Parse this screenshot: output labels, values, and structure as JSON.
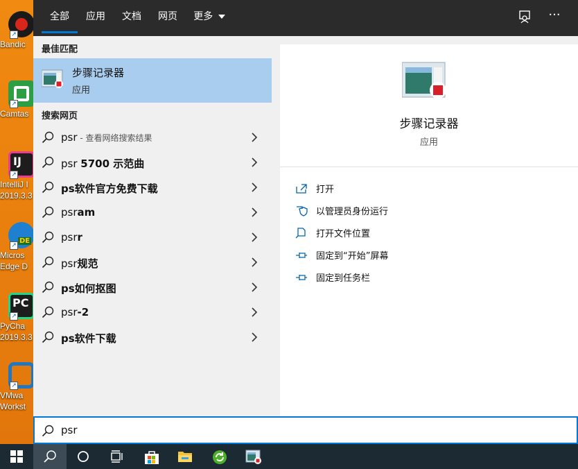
{
  "desktop": {
    "icons": [
      {
        "label": "Bandic",
        "color": "#c0392b"
      },
      {
        "label": "Camtas",
        "color": "#2e9e44"
      },
      {
        "label": "IntelliJ I\n2019.3.3",
        "color": "#1d1d1d"
      },
      {
        "label": "Micros\nEdge D",
        "color": "#1f7fd1"
      },
      {
        "label": "PyCha\n2019.3.3",
        "color": "#21d789"
      },
      {
        "label": "VMwa\nWorkst",
        "color": "#1f78c1"
      }
    ]
  },
  "nav": {
    "tabs": [
      {
        "label": "全部",
        "active": true
      },
      {
        "label": "应用",
        "active": false
      },
      {
        "label": "文档",
        "active": false
      },
      {
        "label": "网页",
        "active": false
      },
      {
        "label": "更多",
        "active": false
      }
    ],
    "feedback_icon": "feedback-icon",
    "more_icon": "ellipsis-icon",
    "more_glyph": "···"
  },
  "best_match": {
    "header": "最佳匹配",
    "name": "步骤记录器",
    "type": "应用"
  },
  "web": {
    "header": "搜索网页",
    "rows": [
      {
        "prefix": "psr",
        "bold": "",
        "hint": " - 查看网络搜索结果"
      },
      {
        "prefix": "psr ",
        "bold": "5700 示范曲",
        "hint": ""
      },
      {
        "prefix": "",
        "bold": "ps软件官方免费下载",
        "hint": ""
      },
      {
        "prefix": "psr",
        "bold": "am",
        "hint": ""
      },
      {
        "prefix": "psr",
        "bold": "r",
        "hint": ""
      },
      {
        "prefix": "psr",
        "bold": "规范",
        "hint": ""
      },
      {
        "prefix": "",
        "bold": "ps如何抠图",
        "hint": ""
      },
      {
        "prefix": "psr",
        "bold": "-2",
        "hint": ""
      },
      {
        "prefix": "",
        "bold": "ps软件下载",
        "hint": ""
      }
    ]
  },
  "detail": {
    "title": "步骤记录器",
    "subtitle": "应用",
    "actions": [
      {
        "label": "打开",
        "icon": "open-icon"
      },
      {
        "label": "以管理员身份运行",
        "icon": "shield-icon"
      },
      {
        "label": "打开文件位置",
        "icon": "file-location-icon"
      },
      {
        "label": "固定到“开始”屏幕",
        "icon": "pin-icon"
      },
      {
        "label": "固定到任务栏",
        "icon": "pin-icon"
      }
    ]
  },
  "search": {
    "value": "psr"
  },
  "taskbar": {
    "items": [
      "windows-start-icon",
      "search-icon",
      "cortana-icon",
      "task-view-icon",
      "store-icon",
      "file-explorer-icon",
      "refresh-app-icon",
      "steps-recorder-icon"
    ]
  },
  "colors": {
    "accent": "#0078d7",
    "selection": "#a9cdee",
    "nav_bg": "#2b2b2b",
    "taskbar_bg": "#1c2a33"
  }
}
